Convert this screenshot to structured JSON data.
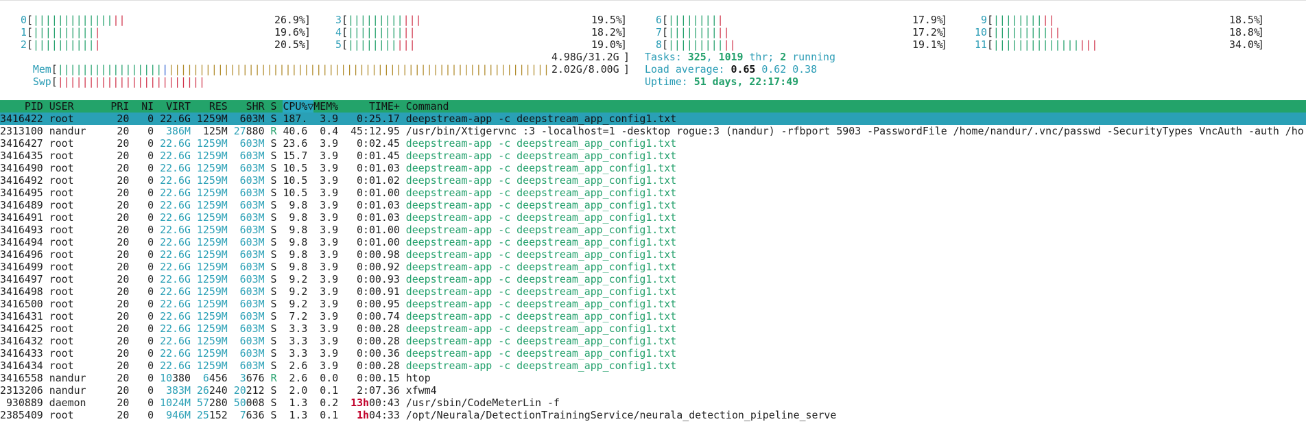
{
  "cpus": [
    {
      "id": "0",
      "green": 13,
      "red": 2,
      "pct": "26.9%"
    },
    {
      "id": "1",
      "green": 10,
      "red": 1,
      "pct": "19.6%"
    },
    {
      "id": "2",
      "green": 10,
      "red": 1,
      "pct": "20.5%"
    },
    {
      "id": "3",
      "green": 9,
      "red": 3,
      "pct": "19.5%"
    },
    {
      "id": "4",
      "green": 9,
      "red": 2,
      "pct": "18.2%"
    },
    {
      "id": "5",
      "green": 8,
      "red": 3,
      "pct": "19.0%"
    },
    {
      "id": "6",
      "green": 8,
      "red": 1,
      "pct": "17.9%"
    },
    {
      "id": "7",
      "green": 8,
      "red": 2,
      "pct": "17.2%"
    },
    {
      "id": "8",
      "green": 9,
      "red": 2,
      "pct": "19.1%"
    },
    {
      "id": "9",
      "green": 8,
      "red": 2,
      "pct": "18.5%"
    },
    {
      "id": "10",
      "green": 9,
      "red": 2,
      "pct": "18.8%"
    },
    {
      "id": "11",
      "green": 14,
      "red": 3,
      "pct": "34.0%"
    }
  ],
  "mem": {
    "label": "Mem",
    "value": "4.98G/31.2G",
    "green": 17,
    "blue": 1,
    "yellow": 62
  },
  "swp": {
    "label": "Swp",
    "value": "2.02G/8.00G",
    "red": 24
  },
  "tasks": {
    "prefix": "Tasks: ",
    "count": "325",
    "sep1": ", ",
    "threads": "1019",
    "thr_label": " thr; ",
    "running": "2",
    "running_label": " running"
  },
  "load": {
    "prefix": "Load average: ",
    "l1": "0.65",
    "l5": "0.62",
    "l15": "0.38"
  },
  "uptime": {
    "prefix": "Uptime: ",
    "value": "51 days, 22:17:49"
  },
  "columns": {
    "pid": "PID",
    "user": "USER",
    "pri": "PRI",
    "ni": "NI",
    "virt": "VIRT",
    "res": "RES",
    "shr": "SHR",
    "s": "S",
    "cpu": "CPU%▽",
    "mem": "MEM%",
    "time": "TIME+",
    "command": "Command"
  },
  "processes": [
    {
      "pid": "3416422",
      "user": "root",
      "pri": "20",
      "ni": "0",
      "virt": "22.6G",
      "res": "1259M",
      "shr": "603M",
      "s": "S",
      "cpu": "187.",
      "mem": "3.9",
      "time": "0:25.17",
      "cmd": "deepstream-app -c deepstream_app_config1.txt",
      "thread": false,
      "selected": true
    },
    {
      "pid": "2313100",
      "user": "nandur",
      "pri": "20",
      "ni": "0",
      "virt": "386M",
      "res": "125M",
      "shr": "27880",
      "s": "R",
      "cpu": "40.6",
      "mem": "0.4",
      "time": "45:12.95",
      "cmd": "/usr/bin/Xtigervnc :3 -localhost=1 -desktop rogue:3 (nandur) -rfbport 5903 -PasswordFile /home/nandur/.vnc/passwd -SecurityTypes VncAuth -auth /ho",
      "thread": false,
      "selected": false
    },
    {
      "pid": "3416427",
      "user": "root",
      "pri": "20",
      "ni": "0",
      "virt": "22.6G",
      "res": "1259M",
      "shr": "603M",
      "s": "S",
      "cpu": "23.6",
      "mem": "3.9",
      "time": "0:02.45",
      "cmd": "deepstream-app -c deepstream_app_config1.txt",
      "thread": true,
      "selected": false
    },
    {
      "pid": "3416435",
      "user": "root",
      "pri": "20",
      "ni": "0",
      "virt": "22.6G",
      "res": "1259M",
      "shr": "603M",
      "s": "S",
      "cpu": "15.7",
      "mem": "3.9",
      "time": "0:01.45",
      "cmd": "deepstream-app -c deepstream_app_config1.txt",
      "thread": true,
      "selected": false
    },
    {
      "pid": "3416490",
      "user": "root",
      "pri": "20",
      "ni": "0",
      "virt": "22.6G",
      "res": "1259M",
      "shr": "603M",
      "s": "S",
      "cpu": "10.5",
      "mem": "3.9",
      "time": "0:01.03",
      "cmd": "deepstream-app -c deepstream_app_config1.txt",
      "thread": true,
      "selected": false
    },
    {
      "pid": "3416492",
      "user": "root",
      "pri": "20",
      "ni": "0",
      "virt": "22.6G",
      "res": "1259M",
      "shr": "603M",
      "s": "S",
      "cpu": "10.5",
      "mem": "3.9",
      "time": "0:01.02",
      "cmd": "deepstream-app -c deepstream_app_config1.txt",
      "thread": true,
      "selected": false
    },
    {
      "pid": "3416495",
      "user": "root",
      "pri": "20",
      "ni": "0",
      "virt": "22.6G",
      "res": "1259M",
      "shr": "603M",
      "s": "S",
      "cpu": "10.5",
      "mem": "3.9",
      "time": "0:01.00",
      "cmd": "deepstream-app -c deepstream_app_config1.txt",
      "thread": true,
      "selected": false
    },
    {
      "pid": "3416489",
      "user": "root",
      "pri": "20",
      "ni": "0",
      "virt": "22.6G",
      "res": "1259M",
      "shr": "603M",
      "s": "S",
      "cpu": "9.8",
      "mem": "3.9",
      "time": "0:01.03",
      "cmd": "deepstream-app -c deepstream_app_config1.txt",
      "thread": true,
      "selected": false
    },
    {
      "pid": "3416491",
      "user": "root",
      "pri": "20",
      "ni": "0",
      "virt": "22.6G",
      "res": "1259M",
      "shr": "603M",
      "s": "S",
      "cpu": "9.8",
      "mem": "3.9",
      "time": "0:01.03",
      "cmd": "deepstream-app -c deepstream_app_config1.txt",
      "thread": true,
      "selected": false
    },
    {
      "pid": "3416493",
      "user": "root",
      "pri": "20",
      "ni": "0",
      "virt": "22.6G",
      "res": "1259M",
      "shr": "603M",
      "s": "S",
      "cpu": "9.8",
      "mem": "3.9",
      "time": "0:01.00",
      "cmd": "deepstream-app -c deepstream_app_config1.txt",
      "thread": true,
      "selected": false
    },
    {
      "pid": "3416494",
      "user": "root",
      "pri": "20",
      "ni": "0",
      "virt": "22.6G",
      "res": "1259M",
      "shr": "603M",
      "s": "S",
      "cpu": "9.8",
      "mem": "3.9",
      "time": "0:01.00",
      "cmd": "deepstream-app -c deepstream_app_config1.txt",
      "thread": true,
      "selected": false
    },
    {
      "pid": "3416496",
      "user": "root",
      "pri": "20",
      "ni": "0",
      "virt": "22.6G",
      "res": "1259M",
      "shr": "603M",
      "s": "S",
      "cpu": "9.8",
      "mem": "3.9",
      "time": "0:00.98",
      "cmd": "deepstream-app -c deepstream_app_config1.txt",
      "thread": true,
      "selected": false
    },
    {
      "pid": "3416499",
      "user": "root",
      "pri": "20",
      "ni": "0",
      "virt": "22.6G",
      "res": "1259M",
      "shr": "603M",
      "s": "S",
      "cpu": "9.8",
      "mem": "3.9",
      "time": "0:00.92",
      "cmd": "deepstream-app -c deepstream_app_config1.txt",
      "thread": true,
      "selected": false
    },
    {
      "pid": "3416497",
      "user": "root",
      "pri": "20",
      "ni": "0",
      "virt": "22.6G",
      "res": "1259M",
      "shr": "603M",
      "s": "S",
      "cpu": "9.2",
      "mem": "3.9",
      "time": "0:00.93",
      "cmd": "deepstream-app -c deepstream_app_config1.txt",
      "thread": true,
      "selected": false
    },
    {
      "pid": "3416498",
      "user": "root",
      "pri": "20",
      "ni": "0",
      "virt": "22.6G",
      "res": "1259M",
      "shr": "603M",
      "s": "S",
      "cpu": "9.2",
      "mem": "3.9",
      "time": "0:00.91",
      "cmd": "deepstream-app -c deepstream_app_config1.txt",
      "thread": true,
      "selected": false
    },
    {
      "pid": "3416500",
      "user": "root",
      "pri": "20",
      "ni": "0",
      "virt": "22.6G",
      "res": "1259M",
      "shr": "603M",
      "s": "S",
      "cpu": "9.2",
      "mem": "3.9",
      "time": "0:00.95",
      "cmd": "deepstream-app -c deepstream_app_config1.txt",
      "thread": true,
      "selected": false
    },
    {
      "pid": "3416431",
      "user": "root",
      "pri": "20",
      "ni": "0",
      "virt": "22.6G",
      "res": "1259M",
      "shr": "603M",
      "s": "S",
      "cpu": "7.2",
      "mem": "3.9",
      "time": "0:00.74",
      "cmd": "deepstream-app -c deepstream_app_config1.txt",
      "thread": true,
      "selected": false
    },
    {
      "pid": "3416425",
      "user": "root",
      "pri": "20",
      "ni": "0",
      "virt": "22.6G",
      "res": "1259M",
      "shr": "603M",
      "s": "S",
      "cpu": "3.3",
      "mem": "3.9",
      "time": "0:00.28",
      "cmd": "deepstream-app -c deepstream_app_config1.txt",
      "thread": true,
      "selected": false
    },
    {
      "pid": "3416432",
      "user": "root",
      "pri": "20",
      "ni": "0",
      "virt": "22.6G",
      "res": "1259M",
      "shr": "603M",
      "s": "S",
      "cpu": "3.3",
      "mem": "3.9",
      "time": "0:00.28",
      "cmd": "deepstream-app -c deepstream_app_config1.txt",
      "thread": true,
      "selected": false
    },
    {
      "pid": "3416433",
      "user": "root",
      "pri": "20",
      "ni": "0",
      "virt": "22.6G",
      "res": "1259M",
      "shr": "603M",
      "s": "S",
      "cpu": "3.3",
      "mem": "3.9",
      "time": "0:00.36",
      "cmd": "deepstream-app -c deepstream_app_config1.txt",
      "thread": true,
      "selected": false
    },
    {
      "pid": "3416434",
      "user": "root",
      "pri": "20",
      "ni": "0",
      "virt": "22.6G",
      "res": "1259M",
      "shr": "603M",
      "s": "S",
      "cpu": "2.6",
      "mem": "3.9",
      "time": "0:00.28",
      "cmd": "deepstream-app -c deepstream_app_config1.txt",
      "thread": true,
      "selected": false
    },
    {
      "pid": "3416558",
      "user": "nandur",
      "pri": "20",
      "ni": "0",
      "virt": "10380",
      "res": "6456",
      "shr": "3676",
      "s": "R",
      "cpu": "2.6",
      "mem": "0.0",
      "time": "0:00.15",
      "cmd": "htop",
      "thread": false,
      "selected": false
    },
    {
      "pid": "2313206",
      "user": "nandur",
      "pri": "20",
      "ni": "0",
      "virt": "383M",
      "res": "26240",
      "shr": "20212",
      "s": "S",
      "cpu": "2.0",
      "mem": "0.1",
      "time": "2:07.36",
      "cmd": "xfwm4",
      "thread": false,
      "selected": false
    },
    {
      "pid": "930889",
      "user": "daemon",
      "pri": "20",
      "ni": "0",
      "virt": "1024M",
      "res": "57280",
      "shr": "50008",
      "s": "S",
      "cpu": "1.3",
      "mem": "0.2",
      "time": "13h00:43",
      "cmd": "/usr/sbin/CodeMeterLin -f",
      "thread": false,
      "selected": false
    },
    {
      "pid": "2385409",
      "user": "root",
      "pri": "20",
      "ni": "0",
      "virt": "946M",
      "res": "25152",
      "shr": "7636",
      "s": "S",
      "cpu": "1.3",
      "mem": "0.1",
      "time": "1h04:33",
      "cmd": "/opt/Neurala/DetectionTrainingService/neurala_detection_pipeline_serve",
      "thread": false,
      "selected": false
    }
  ],
  "colors": {
    "header_bg": "#23a36a",
    "selected_bg": "#2aa0b6",
    "green": "#22a06b",
    "red": "#d0334a",
    "cyan": "#2a9cb5"
  }
}
